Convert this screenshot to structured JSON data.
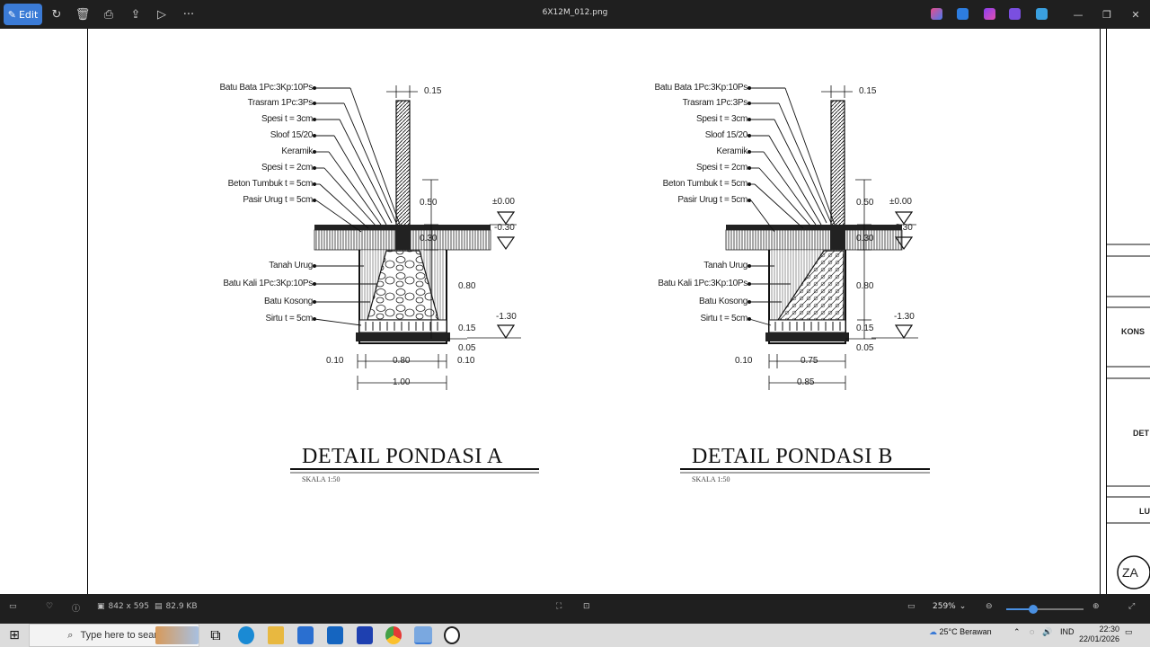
{
  "titlebar": {
    "edit_label": "Edit",
    "file_name": "6X12M_012.png",
    "more_label": "···"
  },
  "drawing": {
    "detail_a": {
      "title": "DETAIL PONDASI A",
      "scale": "SKALA 1:50",
      "labels": [
        "Batu Bata 1Pc:3Kp:10Ps",
        "Trasram 1Pc:3Ps",
        "Spesi t = 3cm",
        "Sloof 15/20",
        "Keramik",
        "Spesi t = 2cm",
        "Beton Tumbuk t = 5cm",
        "Pasir Urug t = 5cm"
      ],
      "labels_lower": [
        "Tanah Urug",
        "Batu Kali 1Pc:3Kp:10Ps",
        "Batu Kosong",
        "Sirtu t = 5cm"
      ],
      "dims": {
        "wall": "0.15",
        "h1": "0.50",
        "h2": "0.30",
        "h3": "0.80",
        "h4": "0.15",
        "h5": "0.05",
        "lev0": "±0.00",
        "lev1": "-0.30",
        "lev2": "-1.30",
        "left": "0.10",
        "mid": "0.80",
        "right": "0.10",
        "total": "1.00"
      }
    },
    "detail_b": {
      "title": "DETAIL PONDASI B",
      "scale": "SKALA 1:50",
      "labels": [
        "Batu Bata 1Pc:3Kp:10Ps",
        "Trasram 1Pc:3Ps",
        "Spesi t = 3cm",
        "Sloof 15/20",
        "Keramik",
        "Spesi t = 2cm",
        "Beton Tumbuk t = 5cm",
        "Pasir Urug t = 5cm"
      ],
      "labels_lower": [
        "Tanah Urug",
        "Batu Kali 1Pc:3Kp:10Ps",
        "Batu Kosong",
        "Sirtu t = 5cm"
      ],
      "dims": {
        "wall": "0.15",
        "h1": "0.50",
        "h2": "0.30",
        "h3": "0.80",
        "h4": "0.15",
        "h5": "0.05",
        "lev0": "±0.00",
        "lev1": "-0.30",
        "lev2": "-1.30",
        "left": "0.10",
        "mid": "0.75",
        "total": "0.85"
      }
    },
    "right_panel": {
      "text1": "KONS",
      "text2": "DET",
      "text3": "LU",
      "logo": "ZA"
    }
  },
  "statusbar": {
    "dimensions": "842 x 595",
    "file_size": "82.9 KB",
    "zoom": "259%"
  },
  "taskbar": {
    "search_placeholder": "Type here to search",
    "weather": "25°C  Berawan",
    "lang": "IND",
    "time": "22:30",
    "date": "22/01/2026"
  }
}
